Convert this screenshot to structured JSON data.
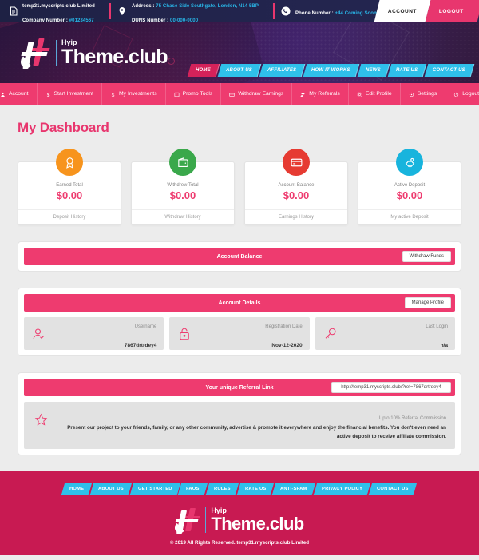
{
  "topbar": {
    "company": {
      "icon": "document-icon",
      "line1": "temp31.myscripts.club Limited",
      "line2_label": "Company Number : ",
      "line2_value": "#01234567"
    },
    "address": {
      "icon": "location-pin-icon",
      "line1_label": "Address : ",
      "line1_value": "75 Chase Side Southgate, London, N14 5BP",
      "line2_label": "DUNS Number : ",
      "line2_value": "00-000-0000"
    },
    "phone": {
      "icon": "phone-icon",
      "label": "Phone Number : ",
      "value": "+44 Coming Soon"
    },
    "account_button": "ACCOUNT",
    "logout_button": "LOGOUT"
  },
  "brand": {
    "small": "Hyip",
    "main": "Theme.club"
  },
  "mainnav": [
    {
      "label": "HOME",
      "active": true
    },
    {
      "label": "ABOUT US",
      "active": false
    },
    {
      "label": "AFFILIATES",
      "active": false
    },
    {
      "label": "HOW IT WORKS",
      "active": false
    },
    {
      "label": "NEWS",
      "active": false
    },
    {
      "label": "RATE US",
      "active": false
    },
    {
      "label": "CONTACT US",
      "active": false
    }
  ],
  "dashnav": [
    {
      "label": "Account",
      "icon": "user-icon"
    },
    {
      "label": "Start Investment",
      "icon": "dollar-icon"
    },
    {
      "label": "My Investments",
      "icon": "dollar-icon"
    },
    {
      "label": "Promo Tools",
      "icon": "image-icon"
    },
    {
      "label": "Withdraw Earnings",
      "icon": "card-icon"
    },
    {
      "label": "My Referrals",
      "icon": "users-icon"
    },
    {
      "label": "Edit Profile",
      "icon": "gear-icon"
    },
    {
      "label": "Settings",
      "icon": "settings-icon"
    },
    {
      "label": "Logout",
      "icon": "power-icon"
    }
  ],
  "page_title": "My Dashboard",
  "cards": [
    {
      "icon": "award-icon",
      "color": "#f7941d",
      "label": "Earned Total",
      "value": "$0.00",
      "footer": "Deposit History"
    },
    {
      "icon": "wallet-icon",
      "color": "#3aa84b",
      "label": "Withdrew Total",
      "value": "$0.00",
      "footer": "Withdraw History"
    },
    {
      "icon": "credit-card-icon",
      "color": "#e63b32",
      "label": "Account Balance",
      "value": "$0.00",
      "footer": "Earnings History"
    },
    {
      "icon": "puzzle-icon",
      "color": "#18b4dd",
      "label": "Active Deposit",
      "value": "$0.00",
      "footer": "My active Deposit"
    }
  ],
  "account_balance": {
    "title": "Account Balance",
    "button": "Withdraw Funds"
  },
  "account_details": {
    "title": "Account Details",
    "button": "Manage Profile",
    "rows": [
      {
        "icon": "user-check-icon",
        "label": "Username",
        "value": "7867drtrdey4"
      },
      {
        "icon": "unlock-icon",
        "label": "Registration Date",
        "value": "Nov-12-2020"
      },
      {
        "icon": "key-icon",
        "label": "Last Login",
        "value": "n/a"
      }
    ]
  },
  "referral": {
    "title": "Your unique Referral Link",
    "link": "http://temp31.myscripts.club/?ref=7867drtrdey4",
    "commission": "Upto 10% Referral Commission",
    "description": "Present our project to your friends, family, or any other community, advertise & promote it everywhere and enjoy the financial benefits. You don't even need an active deposit to receive affiliate commission."
  },
  "footer": {
    "nav": [
      {
        "label": "HOME"
      },
      {
        "label": "ABOUT US"
      },
      {
        "label": "GET STARTED"
      },
      {
        "label": "FAQS"
      },
      {
        "label": "RULES"
      },
      {
        "label": "RATE US"
      },
      {
        "label": "ANTI-SPAM"
      },
      {
        "label": "PRIVACY POLICY"
      },
      {
        "label": "CONTACT US"
      }
    ],
    "copyright": "© 2019 All Rights Reserved. temp31.myscripts.club Limited"
  },
  "colors": {
    "pink": "#ee3b6f",
    "deep_pink": "#c81a52",
    "cyan": "#2fc0ea",
    "dark": "#22244c"
  }
}
